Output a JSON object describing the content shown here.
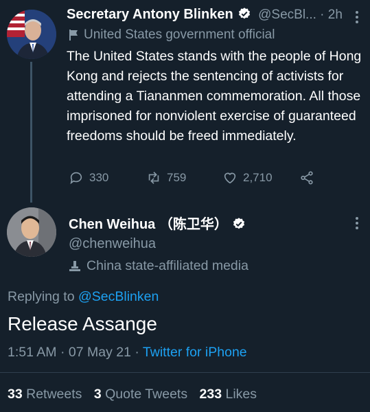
{
  "tweet1": {
    "author_name": "Secretary Antony Blinken",
    "handle_time": "@SecBl... · 2h",
    "label": "United States government official",
    "text": "The United States stands with the people of Hong Kong and rejects the sentencing of activists for attending a Tiananmen commemoration. All those imprisoned for nonviolent exercise of guaranteed freedoms should be freed immediately.",
    "replies": "330",
    "retweets": "759",
    "likes": "2,710"
  },
  "tweet2": {
    "author_name": "Chen Weihua （陈卫华）",
    "handle": "@chenweihua",
    "label": "China state-affiliated media",
    "replying_prefix": "Replying to",
    "replying_handle": "@SecBlinken",
    "text": "Release Assange",
    "timestamp": "1:51 AM · 07 May 21 · ",
    "source": "Twitter for iPhone",
    "stats": {
      "retweets_count": "33",
      "retweets_label": "Retweets",
      "quotes_count": "3",
      "quotes_label": "Quote Tweets",
      "likes_count": "233",
      "likes_label": "Likes"
    }
  },
  "colors": {
    "background": "#15202b",
    "muted": "#8899a6",
    "link": "#1da1f2",
    "verified": "#ffffff"
  },
  "icons": [
    "verified-icon",
    "flag-icon",
    "reply-icon",
    "retweet-icon",
    "like-icon",
    "share-icon",
    "more-icon",
    "media-icon"
  ]
}
